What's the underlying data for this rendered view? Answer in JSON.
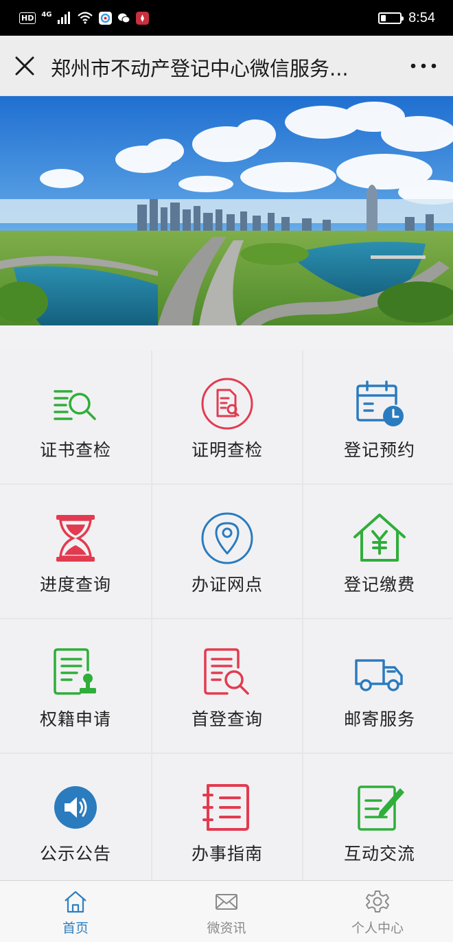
{
  "status_bar": {
    "network_badge": "HD",
    "network_type": "4G",
    "time": "8:54",
    "battery_level": 0.25
  },
  "title_bar": {
    "title": "郑州市不动产登记中心微信服务...",
    "close_icon": "close-icon",
    "more_icon": "more-dots-icon"
  },
  "services": [
    {
      "label": "证书查检",
      "icon": "certificate-search-icon",
      "color": "#2fae3a"
    },
    {
      "label": "证明查检",
      "icon": "document-search-icon",
      "color": "#e23b50"
    },
    {
      "label": "登记预约",
      "icon": "calendar-clock-icon",
      "color": "#2b7bbf"
    },
    {
      "label": "进度查询",
      "icon": "hourglass-icon",
      "color": "#e23b50"
    },
    {
      "label": "办证网点",
      "icon": "location-pin-icon",
      "color": "#2b7bbf"
    },
    {
      "label": "登记缴费",
      "icon": "house-yen-icon",
      "color": "#2fae3a"
    },
    {
      "label": "权籍申请",
      "icon": "document-stamp-icon",
      "color": "#2fae3a"
    },
    {
      "label": "首登查询",
      "icon": "record-search-icon",
      "color": "#e23b50"
    },
    {
      "label": "邮寄服务",
      "icon": "delivery-truck-icon",
      "color": "#2b7bbf"
    },
    {
      "label": "公示公告",
      "icon": "speaker-icon",
      "color": "#2b7bbf"
    },
    {
      "label": "办事指南",
      "icon": "notebook-list-icon",
      "color": "#e23b50"
    },
    {
      "label": "互动交流",
      "icon": "note-pen-icon",
      "color": "#2fae3a"
    }
  ],
  "bottom_nav": [
    {
      "label": "首页",
      "icon": "home-icon",
      "active": true
    },
    {
      "label": "微资讯",
      "icon": "mail-icon",
      "active": false
    },
    {
      "label": "个人中心",
      "icon": "gear-icon",
      "active": false
    }
  ],
  "colors": {
    "accent_blue": "#2b7bbf",
    "accent_red": "#e23b50",
    "accent_green": "#2fae3a",
    "nav_active": "#2d7fc1"
  }
}
